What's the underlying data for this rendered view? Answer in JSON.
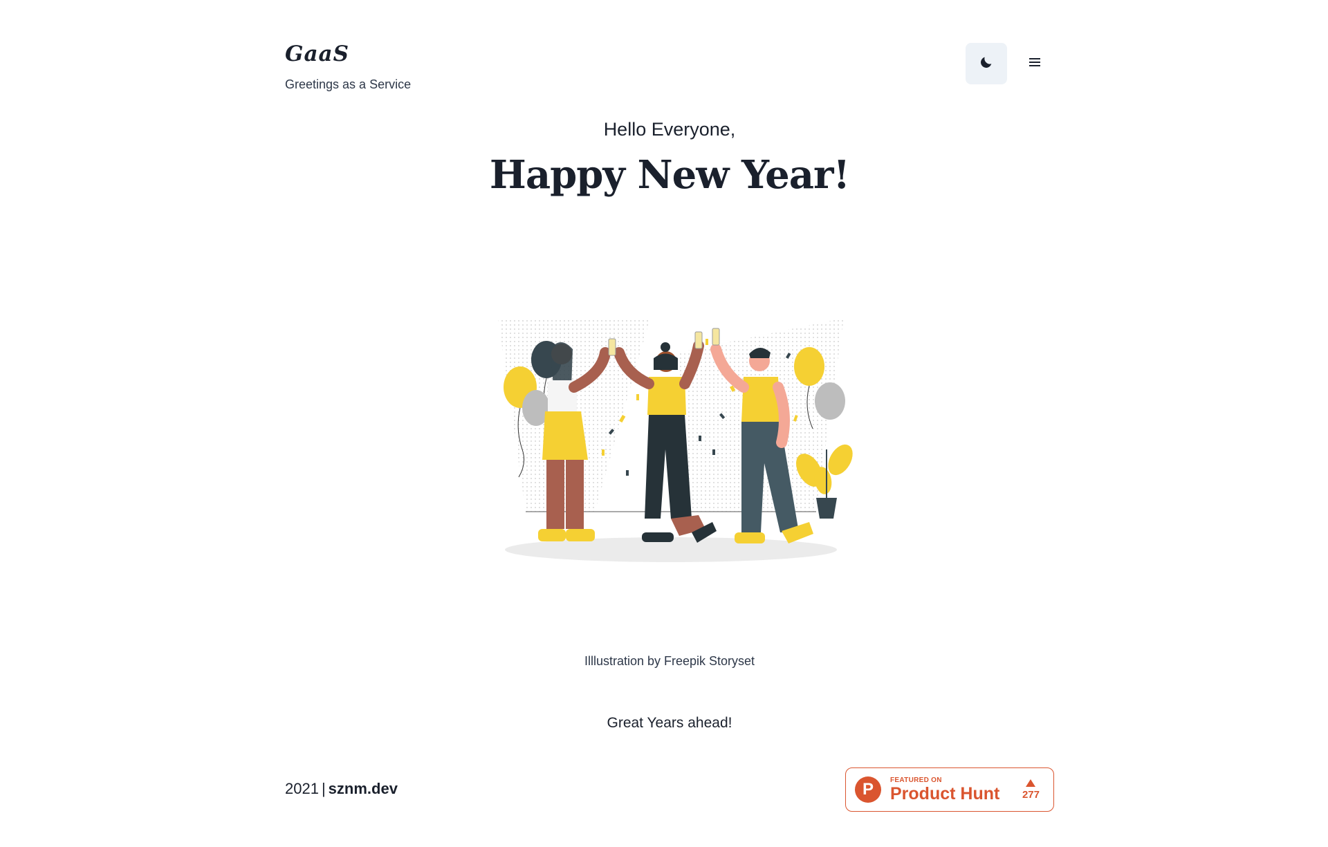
{
  "header": {
    "logo": "GaaS",
    "tagline": "Greetings as a Service",
    "theme_toggle_icon": "moon-icon",
    "menu_icon": "hamburger-menu-icon"
  },
  "main": {
    "greeting": "Hello Everyone,",
    "headline": "Happy New Year!",
    "illustration_icon": "new-year-party-illustration",
    "credit": "Illlustration by Freepik Storyset",
    "wish": "Great Years ahead!"
  },
  "footer": {
    "year": "2021",
    "separator": "|",
    "site": "sznm.dev",
    "product_hunt": {
      "logo_letter": "P",
      "featured_on": "FEATURED ON",
      "name": "Product Hunt",
      "votes": "277"
    }
  },
  "colors": {
    "text": "#1a202c",
    "button_bg": "#edf2f7",
    "product_hunt": "#da552f",
    "accent_yellow": "#f5d033"
  }
}
